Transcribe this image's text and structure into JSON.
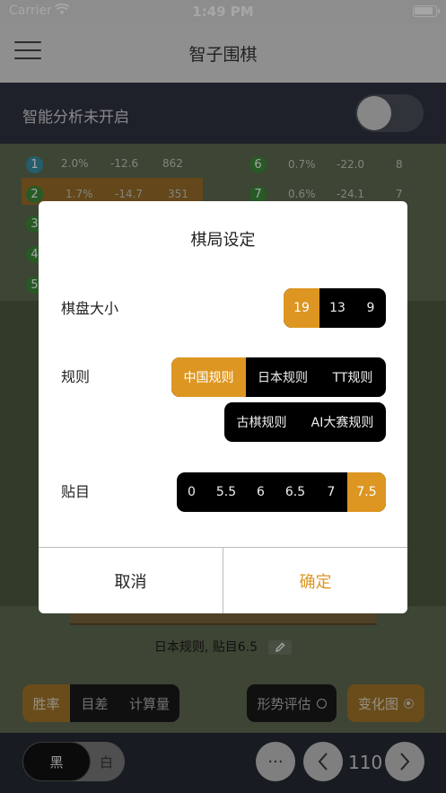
{
  "status": {
    "carrier": "Carrier",
    "time": "1:49 PM"
  },
  "nav": {
    "title": "智子围棋"
  },
  "analysis": {
    "label": "智能分析未开启",
    "enabled": false
  },
  "candidates": [
    {
      "n": "1",
      "win": "2.0%",
      "score": "-12.6",
      "visits": "862"
    },
    {
      "n": "2",
      "win": "1.7%",
      "score": "-14.7",
      "visits": "351"
    },
    {
      "n": "3"
    },
    {
      "n": "4"
    },
    {
      "n": "5"
    },
    {
      "n": "6",
      "win": "0.7%",
      "score": "-22.0",
      "visits": "8"
    },
    {
      "n": "7",
      "win": "0.6%",
      "score": "-24.1",
      "visits": "7"
    }
  ],
  "rule_info": "日本规则, 贴目6.5",
  "controls": {
    "seg": [
      "胜率",
      "目差",
      "计算量"
    ],
    "assess": "形势评估",
    "change": "变化图"
  },
  "bottom": {
    "black": "黑",
    "white": "白",
    "more": "···",
    "move": "110"
  },
  "dialog": {
    "title": "棋局设定",
    "board_size_label": "棋盘大小",
    "board_sizes": [
      "19",
      "13",
      "9"
    ],
    "rules_label": "规则",
    "rules_row1": [
      "中国规则",
      "日本规则",
      "TT规则"
    ],
    "rules_row2": [
      "古棋规则",
      "AI大赛规则"
    ],
    "komi_label": "贴目",
    "komi": [
      "0",
      "5.5",
      "6",
      "6.5",
      "7",
      "7.5"
    ],
    "cancel": "取消",
    "confirm": "确定"
  },
  "colors": {
    "accent": "#dd9622",
    "dark": "#000000"
  }
}
